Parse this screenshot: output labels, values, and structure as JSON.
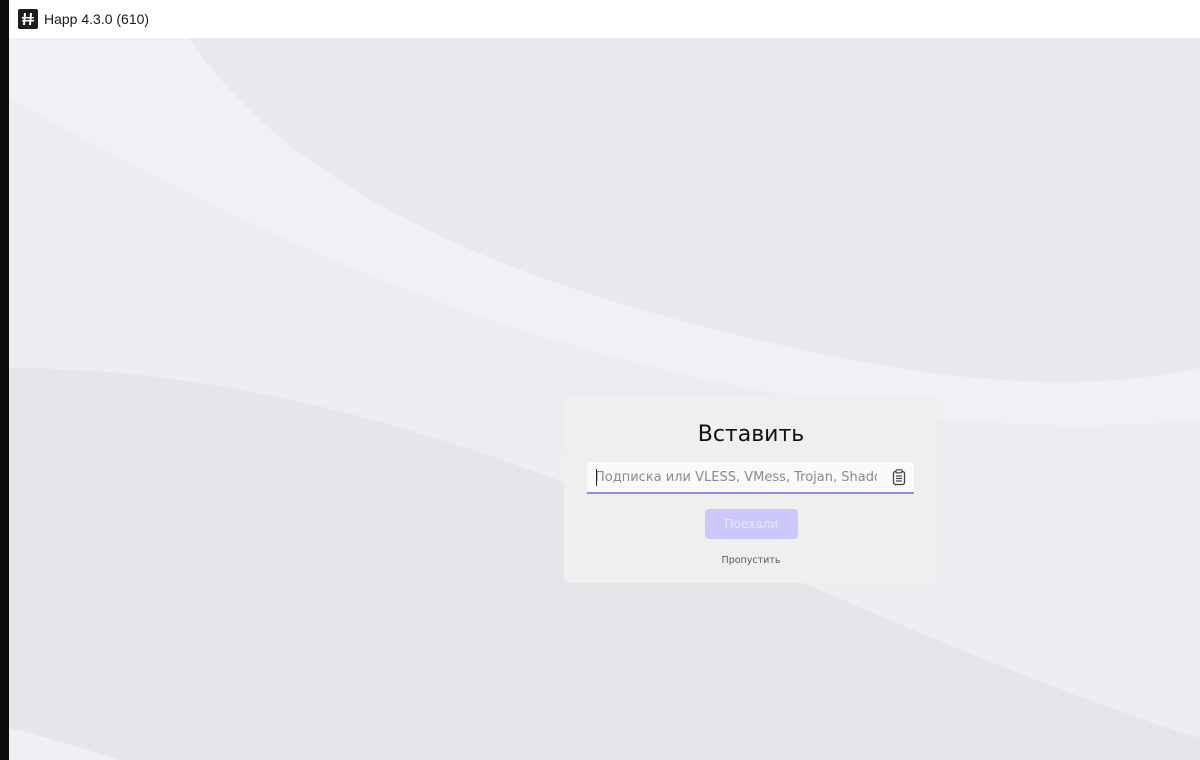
{
  "window": {
    "title": "Happ 4.3.0 (610)",
    "logo_icon": "happ-logo-icon"
  },
  "colors": {
    "accent": "#8e86f0",
    "button_disabled": "#cdc8fb",
    "background": "#e8e8ed",
    "card": "#efeff0"
  },
  "dialog": {
    "title": "Вставить",
    "input": {
      "value": "",
      "placeholder": "Подписка или VLESS, VMess, Trojan, ShadowSo...",
      "paste_icon": "clipboard-icon"
    },
    "submit_label": "Поехали",
    "skip_label": "Пропустить"
  }
}
